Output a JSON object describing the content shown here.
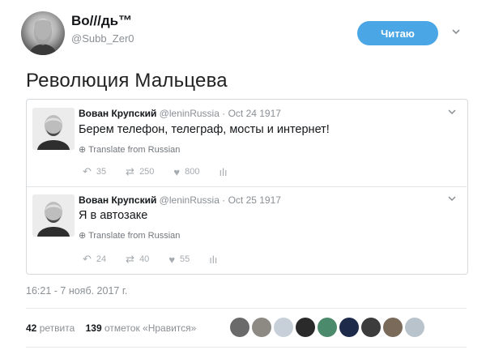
{
  "author": {
    "display_name": "Во///дь™",
    "handle": "@Subb_Zer0",
    "follow_label": "Читаю"
  },
  "tweet_text": "Революция Мальцева",
  "quoted_tweets": [
    {
      "name": "Вован Крупский",
      "handle": "@leninRussia",
      "date": "· Oct 24 1917",
      "text": "Берем телефон, телеграф, мосты и интернет!",
      "translate": "Translate from Russian",
      "replies": "35",
      "retweets": "250",
      "likes": "800"
    },
    {
      "name": "Вован Крупский",
      "handle": "@leninRussia",
      "date": "· Oct 25 1917",
      "text": "Я в автозаке",
      "translate": "Translate from Russian",
      "replies": "24",
      "retweets": "40",
      "likes": "55"
    }
  ],
  "timestamp": "16:21 - 7 нояб. 2017 г.",
  "stats": {
    "retweets_count": "42",
    "retweets_label": "ретвита",
    "likes_count": "139",
    "likes_label": "отметок «Нравится»"
  },
  "likers": [
    "#6a6a6a",
    "#8d8a84",
    "#c7d0d8",
    "#2a2a2a",
    "#4b8a6a",
    "#1e2a4a",
    "#3c3c3c",
    "#7a6a5a",
    "#b9c3cc"
  ],
  "colors": {
    "accent": "#4aa6e4"
  }
}
